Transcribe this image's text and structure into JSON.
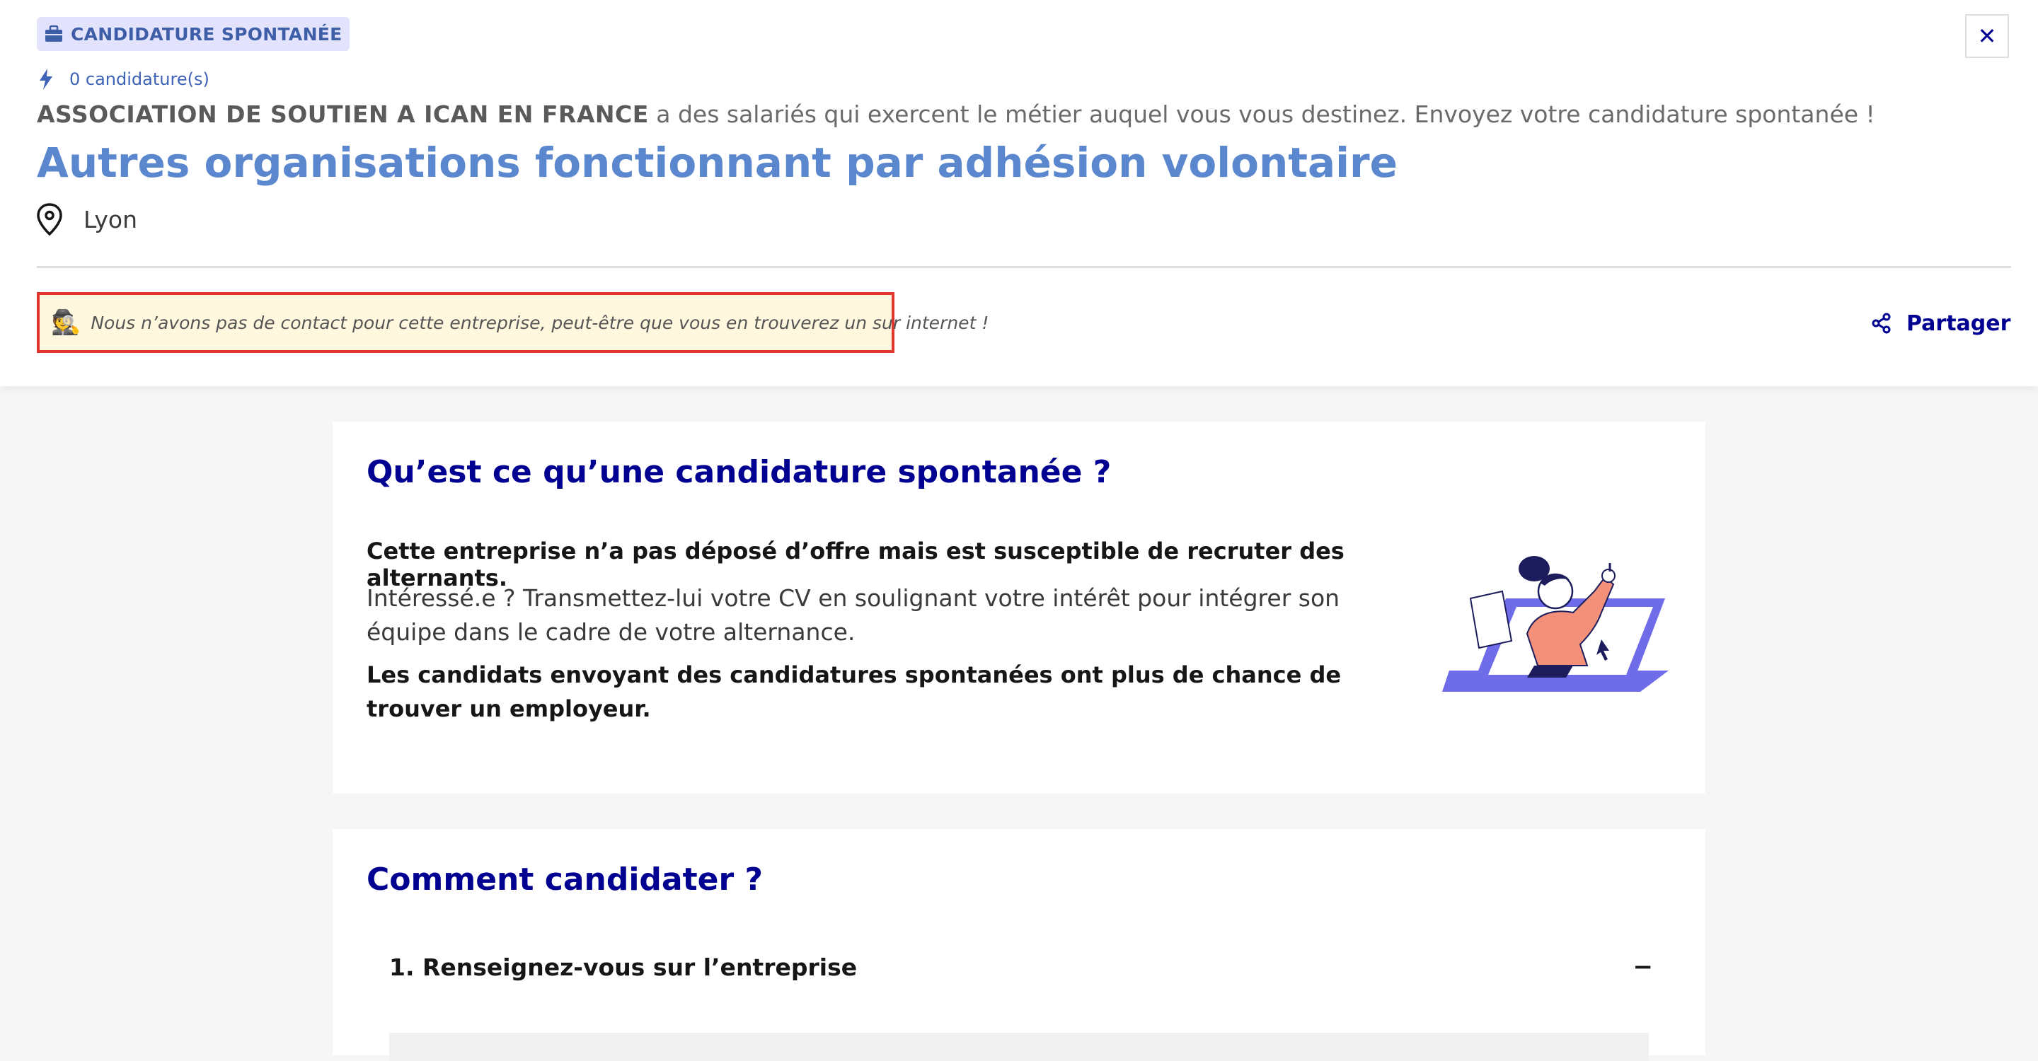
{
  "header": {
    "tag_label": "CANDIDATURE SPONTANÉE",
    "applications_count": "0 candidature(s)",
    "company_name": "ASSOCIATION DE SOUTIEN A ICAN EN FRANCE",
    "company_sentence": " a des salariés qui exercent le métier auquel vous vous destinez. Envoyez votre candidature spontanée !",
    "job_title": "Autres organisations fonctionnant par adhésion volontaire",
    "location": "Lyon",
    "notice_emoji": "🕵️",
    "notice_text": "Nous n’avons pas de contact pour cette entreprise, peut-être que vous en trouverez un sur internet !",
    "share_label": "Partager",
    "close_label": "✕"
  },
  "info_card": {
    "title": "Qu’est ce qu’une candidature spontanée ?",
    "paragraph1": "Cette entreprise n’a pas déposé d’offre mais est susceptible de recruter des alternants.",
    "paragraph2": "Intéressé.e ? Transmettez-lui votre CV en soulignant votre intérêt pour intégrer son équipe dans le cadre de votre alternance.",
    "paragraph3": "Les candidats envoyant des candidatures spontanées ont plus de chance de trouver un employeur."
  },
  "how_card": {
    "title": "Comment candidater ?",
    "step1_label": "1. Renseignez-vous sur l’entreprise",
    "step1_toggle": "−"
  },
  "colors": {
    "accent_blue": "#000091",
    "title_blue": "#5a87cd",
    "tag_bg": "#e3e3fd",
    "notice_border": "#e1352e",
    "notice_bg": "#fff8de",
    "illustration_purple": "#6e6ce8",
    "illustration_salmon": "#f2907a"
  },
  "icons": {
    "tag": "briefcase-icon",
    "count": "lightning-icon",
    "location": "map-pin-icon",
    "share": "share-icon",
    "close": "close-icon"
  }
}
